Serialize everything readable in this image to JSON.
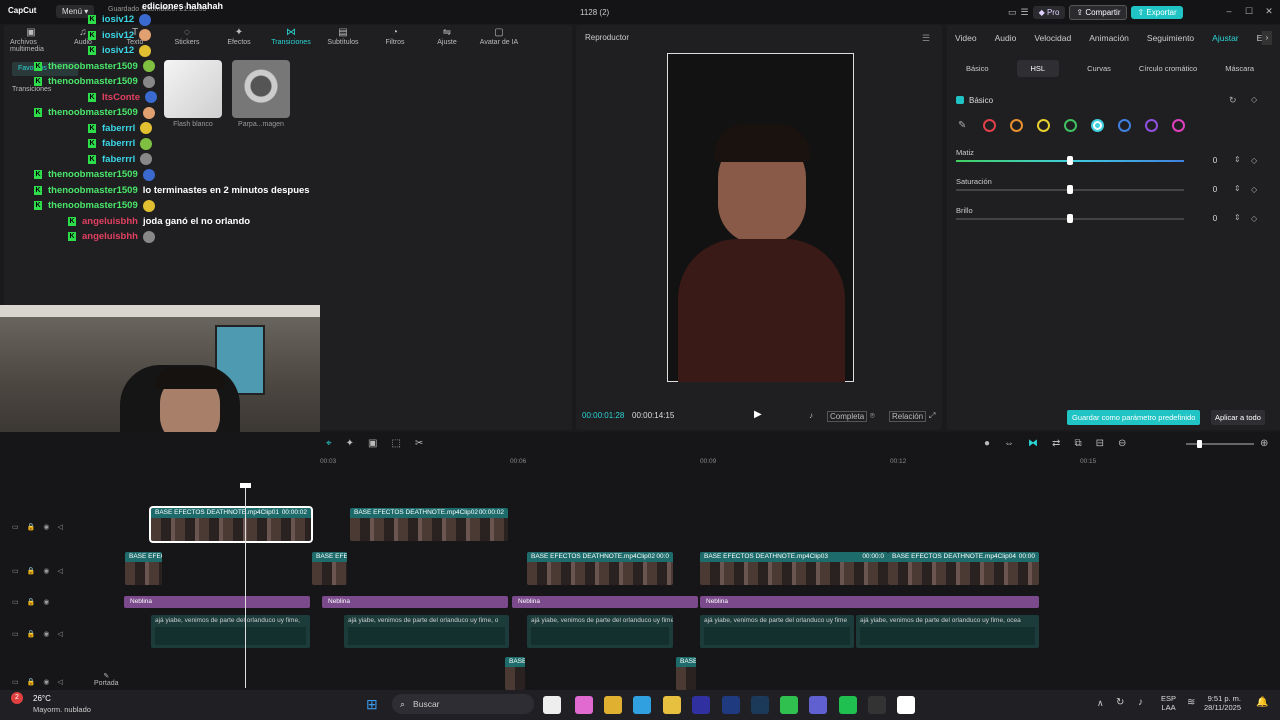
{
  "app": {
    "logo": "CapCut",
    "menu": "Menú",
    "project_heading": "ediciones hahahah",
    "autosave": "Guardado automático: 21:51:03",
    "project_name": "1128 (2)",
    "pro": "Pro",
    "share": "Compartir",
    "export": "Exportar"
  },
  "toolbar": {
    "tools": [
      {
        "label": "Archivos multimedia",
        "icon": "media-icon"
      },
      {
        "label": "Audio",
        "icon": "audio-icon"
      },
      {
        "label": "Texto",
        "icon": "text-icon"
      },
      {
        "label": "Stickers",
        "icon": "sticker-icon"
      },
      {
        "label": "Efectos",
        "icon": "effects-icon"
      },
      {
        "label": "Transiciones",
        "icon": "transition-icon"
      },
      {
        "label": "Subtítulos",
        "icon": "subtitle-icon"
      },
      {
        "label": "Filtros",
        "icon": "filter-icon"
      },
      {
        "label": "Ajuste",
        "icon": "adjust-icon"
      },
      {
        "label": "Avatar de IA",
        "icon": "avatar-icon"
      }
    ],
    "active": "Transiciones"
  },
  "sidebar": {
    "favorites": "Favoritos",
    "transitions": "Transiciones"
  },
  "assets": [
    {
      "label": "Flash blanco"
    },
    {
      "label": "Parpa...magen"
    }
  ],
  "chat": [
    {
      "user": "iosiv12",
      "msg": "",
      "color": "#3ad6e6"
    },
    {
      "user": "iosiv12",
      "msg": "",
      "color": "#3ad6e6"
    },
    {
      "user": "iosiv12",
      "msg": "",
      "color": "#3ad6e6"
    },
    {
      "user": "thenoobmaster1509",
      "msg": "",
      "color": "#4ae66a"
    },
    {
      "user": "thenoobmaster1509",
      "msg": "",
      "color": "#4ae66a"
    },
    {
      "user": "ItsConte",
      "msg": "",
      "color": "#e04060"
    },
    {
      "user": "thenoobmaster1509",
      "msg": "",
      "color": "#4ae66a"
    },
    {
      "user": "faberrrl",
      "msg": "",
      "color": "#3ad6e6"
    },
    {
      "user": "faberrrl",
      "msg": "",
      "color": "#3ad6e6"
    },
    {
      "user": "faberrrl",
      "msg": "",
      "color": "#3ad6e6"
    },
    {
      "user": "thenoobmaster1509",
      "msg": "",
      "color": "#4ae66a"
    },
    {
      "user": "thenoobmaster1509",
      "msg": "lo terminastes en 2 minutos despues",
      "color": "#4ae66a"
    },
    {
      "user": "thenoobmaster1509",
      "msg": "",
      "color": "#4ae66a"
    },
    {
      "user": "angeluisbhh",
      "msg": "joda ganó el no orlando",
      "color": "#e04060"
    },
    {
      "user": "angeluisbhh",
      "msg": "",
      "color": "#e04060"
    }
  ],
  "player": {
    "title": "Reproductor",
    "current": "00:00:01:28",
    "total": "00:00:14:15",
    "full": "Completa",
    "ratio": "Relación"
  },
  "right": {
    "tabs": [
      "Video",
      "Audio",
      "Velocidad",
      "Animación",
      "Seguimiento",
      "Ajustar",
      "E"
    ],
    "active_tab": "Ajustar",
    "subtabs": [
      "Básico",
      "HSL",
      "Curvas",
      "Círculo cromático",
      "Máscara"
    ],
    "active_subtab": "HSL",
    "section": "Básico",
    "colors": [
      "#e0404a",
      "#e89030",
      "#e8d030",
      "#40c060",
      "#40d0e0",
      "#4080e0",
      "#9050e0",
      "#e040c0"
    ],
    "selected_color": 4,
    "sliders": [
      {
        "label": "Matiz",
        "value": "0",
        "level": 0.5
      },
      {
        "label": "Saturación",
        "value": "0",
        "level": 0.5
      },
      {
        "label": "Brillo",
        "value": "0",
        "level": 0.5
      }
    ],
    "save_default": "Guardar como parámetro predefinido",
    "apply_all": "Aplicar a todo"
  },
  "timeline": {
    "ruler": [
      "00:03",
      "00:06",
      "00:09",
      "00:12",
      "00:15"
    ],
    "main_clips": [
      {
        "label": "BASE EFECTOS DEATHNOTE.mp4Clip01",
        "dur": "00:00:02"
      },
      {
        "label": "BASE EFECTOS DEATHNOTE.mp4Clip02",
        "dur": "00:00:02"
      }
    ],
    "overlay_clips": [
      {
        "label": "BASE EFEC"
      },
      {
        "label": "BASE EFEC"
      },
      {
        "label": "BASE EFECTOS DEATHNOTE.mp4Clip02",
        "dur": "00:0"
      },
      {
        "label": "BASE EFECTOS DEATHNOTE.mp4Clip03",
        "dur": "00:00:0"
      },
      {
        "label": "BASE EFECTOS DEATHNOTE.mp4Clip04",
        "dur": "00:00"
      }
    ],
    "effects": [
      "Neblina",
      "Neblina",
      "Neblina",
      "Neblina"
    ],
    "subtitles": [
      "ajá yiabe, venimos de parte del orlanduco uy fime,",
      "ajá yiabe, venimos de parte del orlanduco uy fime, o",
      "ajá yiabe, venimos de parte del orlanduco uy fime",
      "ajá yiabe, venimos de parte del orlanduco uy fime",
      "ajá yiabe, venimos de parte del orlanduco uy fime, ocea"
    ],
    "small_clips": [
      "BASE",
      "BASE I"
    ],
    "cover": "Portada"
  },
  "taskbar": {
    "temp": "26°C",
    "weather": "Mayorm. nublado",
    "search": "Buscar",
    "lang": "ESP",
    "lang2": "LAA",
    "time": "9:51 p. m.",
    "date": "28/11/2025",
    "badge": "2"
  }
}
